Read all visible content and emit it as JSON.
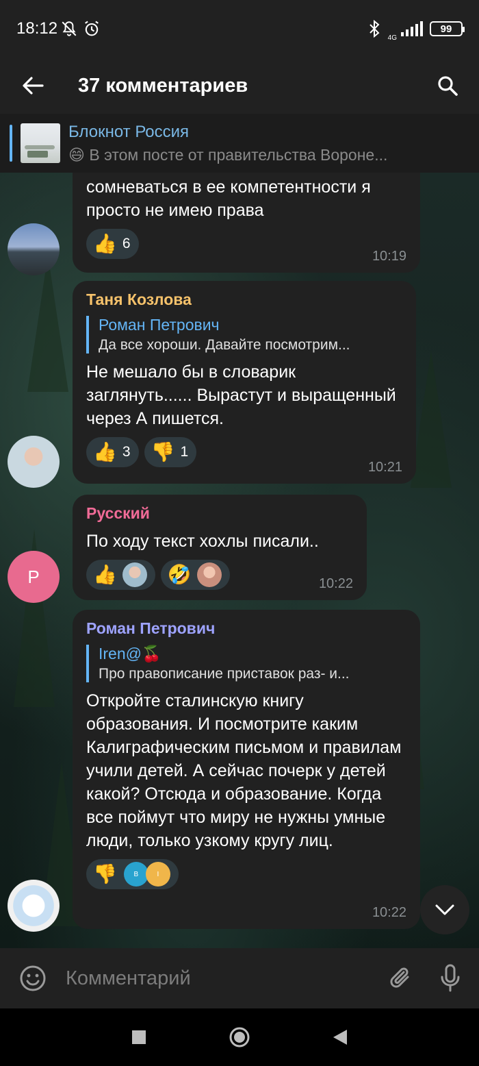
{
  "status_bar": {
    "time": "18:12",
    "battery": "99",
    "network": "4G"
  },
  "app_bar": {
    "title": "37 комментариев"
  },
  "pinned": {
    "channel": "Блокнот Россия",
    "emoji": "😄",
    "preview": "В этом посте от правительства Вороне..."
  },
  "messages": [
    {
      "text": "сомневаться в ее компетентности я просто не имею права",
      "reactions": [
        {
          "emoji": "👍",
          "count": "6"
        }
      ],
      "time": "10:19"
    },
    {
      "author": "Таня Козлова",
      "author_color": "#f6c26b",
      "reply": {
        "name": "Роман Петрович",
        "text": "Да все хороши. Давайте посмотрим...",
        "color": "#64b5f6"
      },
      "text": "Не мешало бы в словарик заглянуть...... Вырастут и выращенный через А пишется.",
      "reactions": [
        {
          "emoji": "👍",
          "count": "3"
        },
        {
          "emoji": "👎",
          "count": "1"
        }
      ],
      "time": "10:21"
    },
    {
      "author": "Русский",
      "author_color": "#f06b97",
      "avatar_letter": "Р",
      "text": "По ходу текст хохлы писали..",
      "reactions": [
        {
          "emoji": "👍"
        },
        {
          "emoji": "🤣"
        }
      ],
      "time": "10:22"
    },
    {
      "author": "Роман Петрович",
      "author_color": "#9ea3ff",
      "reply": {
        "name": "Iren@🍒",
        "text": "Про правописание приставок раз- и...",
        "color": "#64b5f6"
      },
      "text": "Откройте сталинскую книгу образования. И посмотрите каким Калиграфическим письмом и правилам учили детей. А сейчас почерк у детей какой? Отсюда и образование. Когда все поймут что миру не нужны умные люди, только узкому кругу лиц.",
      "reactions": [
        {
          "emoji": "👎"
        }
      ],
      "reactor_letters": [
        "B",
        "I"
      ],
      "time": "10:22"
    }
  ],
  "input": {
    "placeholder": "Комментарий"
  },
  "colors": {
    "bubble": "#212121",
    "accent": "#64b5f6",
    "header": "#212121"
  }
}
